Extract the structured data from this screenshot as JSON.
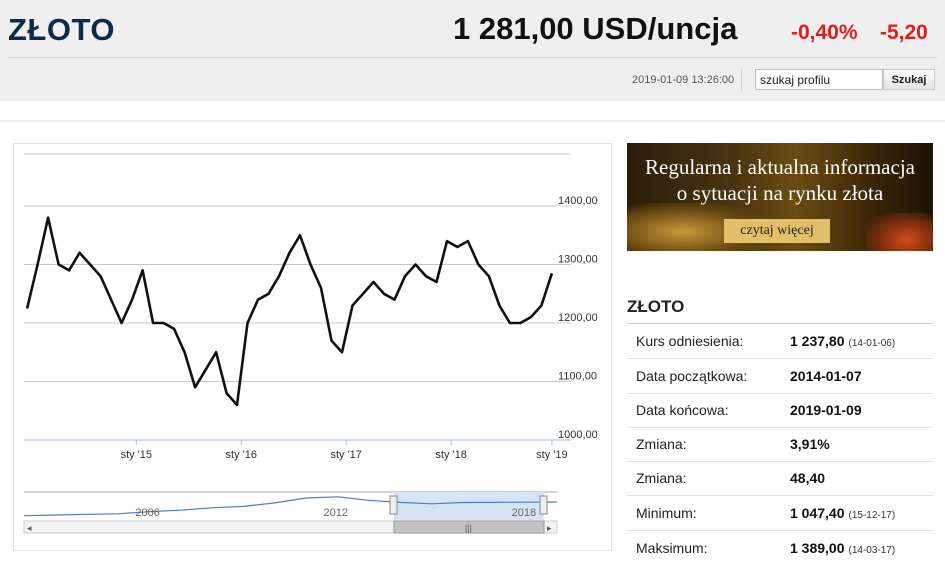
{
  "header": {
    "title": "ZŁOTO",
    "price": "1 281,00 USD/uncja",
    "change_pct": "-0,40%",
    "change_abs": "-5,20",
    "timestamp": "2019-01-09 13:26:00",
    "search_value": "szukaj profilu",
    "search_button": "Szukaj",
    "change_color": "#e21c1c"
  },
  "ad": {
    "line1": "Regularna i aktualna informacja",
    "line2": "o sytuacji na rynku złota",
    "button": "czytaj więcej"
  },
  "panel": {
    "title": "ZŁOTO",
    "rows": [
      {
        "label": "Kurs odniesienia:",
        "value": "1 237,80",
        "note": "(14-01-06)"
      },
      {
        "label": "Data początkowa:",
        "value": "2014-01-07",
        "note": ""
      },
      {
        "label": "Data końcowa:",
        "value": "2019-01-09",
        "note": ""
      },
      {
        "label": "Zmiana:",
        "value": "3,91%",
        "note": ""
      },
      {
        "label": "Zmiana:",
        "value": "48,40",
        "note": ""
      },
      {
        "label": "Minimum:",
        "value": "1 047,40",
        "note": "(15-12-17)"
      },
      {
        "label": "Maksimum:",
        "value": "1 389,00",
        "note": "(14-03-17)"
      }
    ]
  },
  "chart_data": {
    "type": "line",
    "title": "",
    "xlabel": "",
    "ylabel": "",
    "ylim": [
      1000,
      1400
    ],
    "y_ticks": [
      "1400,00",
      "1300,00",
      "1200,00",
      "1100,00",
      "1000,00"
    ],
    "x_ticks": [
      "sty '15",
      "sty '16",
      "sty '17",
      "sty '18",
      "sty '19"
    ],
    "navigator_labels": [
      "2006",
      "2012",
      "2018"
    ],
    "line_color": "#111111",
    "series": [
      {
        "x": [
          2014.0,
          2014.1,
          2014.2,
          2014.3,
          2014.4,
          2014.5,
          2014.6,
          2014.7,
          2014.8,
          2014.9,
          2015.0,
          2015.1,
          2015.2,
          2015.3,
          2015.4,
          2015.5,
          2015.6,
          2015.7,
          2015.8,
          2015.9,
          2016.0,
          2016.1,
          2016.2,
          2016.3,
          2016.4,
          2016.5,
          2016.6,
          2016.7,
          2016.8,
          2016.9,
          2017.0,
          2017.1,
          2017.2,
          2017.3,
          2017.4,
          2017.5,
          2017.6,
          2017.7,
          2017.8,
          2017.9,
          2018.0,
          2018.1,
          2018.2,
          2018.3,
          2018.4,
          2018.5,
          2018.6,
          2018.7,
          2018.8,
          2018.9,
          2019.0
        ],
        "y": [
          1225,
          1300,
          1380,
          1300,
          1290,
          1320,
          1300,
          1280,
          1240,
          1200,
          1240,
          1290,
          1200,
          1200,
          1190,
          1150,
          1090,
          1120,
          1150,
          1080,
          1060,
          1200,
          1240,
          1250,
          1280,
          1320,
          1350,
          1300,
          1260,
          1170,
          1150,
          1230,
          1250,
          1270,
          1250,
          1240,
          1280,
          1300,
          1280,
          1270,
          1340,
          1330,
          1340,
          1300,
          1280,
          1230,
          1200,
          1200,
          1210,
          1230,
          1285
        ]
      }
    ],
    "navigator": {
      "x": [
        2002,
        2003,
        2004,
        2005,
        2006,
        2007,
        2008,
        2009,
        2010,
        2011,
        2012,
        2013,
        2014,
        2015,
        2016,
        2017,
        2018,
        2019
      ],
      "y": [
        310,
        360,
        410,
        440,
        600,
        700,
        870,
        970,
        1220,
        1570,
        1660,
        1410,
        1260,
        1160,
        1250,
        1260,
        1270,
        1285
      ],
      "color": "#4a7fc4"
    }
  }
}
